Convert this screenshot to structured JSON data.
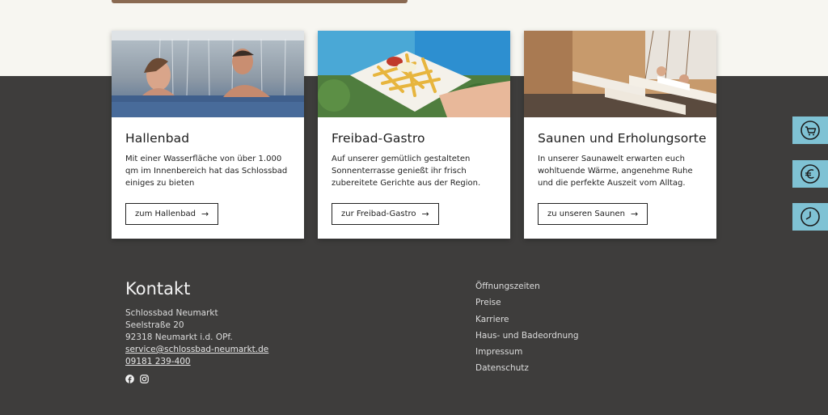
{
  "cards": [
    {
      "title": "Hallenbad",
      "text": "Mit einer Wasserfläche von über 1.000 qm im Innenbereich hat das Schlossbad einiges zu bieten",
      "button": "zum Hallenbad",
      "image": "indoor-pool-photo"
    },
    {
      "title": "Freibad-Gastro",
      "text": "Auf unserer gemütlich gestalteten Sonnenterrasse genießt ihr frisch zubereitete Gerichte aus der Region.",
      "button": "zur Freibad-Gastro",
      "image": "fries-photo"
    },
    {
      "title": "Saunen und Erholungsorte",
      "text": "In unserer Saunawelt erwarten euch wohltuende Wärme, angenehme Ruhe und die perfekte Auszeit vom Alltag.",
      "button": "zu unseren Saunen",
      "image": "sauna-lounge-photo"
    }
  ],
  "button_arrow": "→",
  "side_buttons": [
    "shopping-cart-icon",
    "euro-icon",
    "clock-icon"
  ],
  "kontakt": {
    "title": "Kontakt",
    "name": "Schlossbad Neumarkt",
    "street": "Seelstraße 20",
    "city": "92318 Neumarkt i.d. OPf.",
    "email": "service@schlossbad-neumarkt.de",
    "phone": "09181 239-400"
  },
  "social": [
    "facebook-icon",
    "instagram-icon"
  ],
  "footer_links": [
    "Öffnungszeiten",
    "Preise",
    "Karriere",
    "Haus- und Badeordnung",
    "Impressum",
    "Datenschutz"
  ],
  "colors": {
    "top_background": "#f7f6f1",
    "footer_background": "#3e3d3c",
    "side_button": "#7fc2d4"
  }
}
